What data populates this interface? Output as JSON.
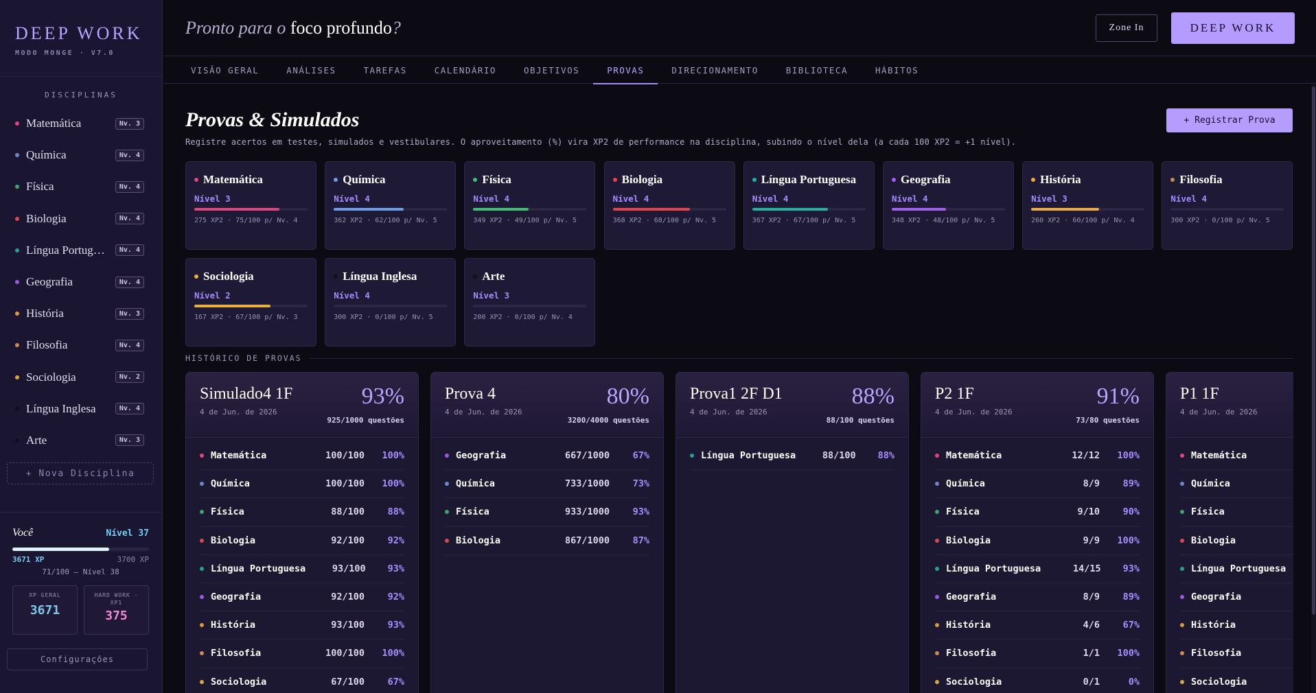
{
  "brand": {
    "title": "DEEP WORK",
    "subtitle": "MODO MONGE · V7.0"
  },
  "sidebar": {
    "heading": "DISCIPLINAS",
    "items": [
      {
        "name": "Matemática",
        "level": "Nv. 3",
        "color": "#e0457f"
      },
      {
        "name": "Química",
        "level": "Nv. 4",
        "color": "#6b86c9"
      },
      {
        "name": "Física",
        "level": "Nv. 4",
        "color": "#3fa36b"
      },
      {
        "name": "Biologia",
        "level": "Nv. 4",
        "color": "#d9474f"
      },
      {
        "name": "Língua Portuguesa",
        "level": "Nv. 4",
        "color": "#25a092"
      },
      {
        "name": "Geografia",
        "level": "Nv. 4",
        "color": "#9b5bd6"
      },
      {
        "name": "História",
        "level": "Nv. 3",
        "color": "#d99a3a"
      },
      {
        "name": "Filosofia",
        "level": "Nv. 4",
        "color": "#c78a54"
      },
      {
        "name": "Sociologia",
        "level": "Nv. 2",
        "color": "#d5a83c"
      },
      {
        "name": "Língua Inglesa",
        "level": "Nv. 4",
        "color": "#111111"
      },
      {
        "name": "Arte",
        "level": "Nv. 3",
        "color": "#111111"
      }
    ],
    "new_label": "+ Nova Disciplina",
    "user": {
      "label": "Você",
      "level": "Nível 37",
      "xp_now": "3671 XP",
      "xp_max": "3700 XP",
      "progress": 0.71,
      "next": "71/100 — Nível 38",
      "stat1_label": "XP GERAL",
      "stat1_value": "3671",
      "stat2_label": "HARD WORK · XP1",
      "stat2_value": "375"
    },
    "settings_label": "Configurações"
  },
  "header": {
    "greeting_pre": "Pronto para o ",
    "greeting_bold": "foco profundo",
    "greeting_post": "?",
    "zone_label": "Zone In",
    "deep_label": "DEEP WORK"
  },
  "tabs": [
    {
      "label": "VISÃO GERAL",
      "active": false
    },
    {
      "label": "ANÁLISES",
      "active": false
    },
    {
      "label": "TAREFAS",
      "active": false
    },
    {
      "label": "CALENDÁRIO",
      "active": false
    },
    {
      "label": "OBJETIVOS",
      "active": false
    },
    {
      "label": "PROVAS",
      "active": true
    },
    {
      "label": "DIRECIONAMENTO",
      "active": false
    },
    {
      "label": "BIBLIOTECA",
      "active": false
    },
    {
      "label": "HÁBITOS",
      "active": false
    }
  ],
  "main": {
    "title": "Provas & Simulados",
    "register_label": "+ Registrar Prova",
    "description": "Registre acertos em testes, simulados e vestibulares. O aproveitamento (%) vira XP2 de performance na disciplina, subindo o nível dela (a cada 100 XP2 = +1 nível).",
    "subjects": [
      {
        "name": "Matemática",
        "level": "Nível 3",
        "xp": "275 XP2 · 75/100 p/ Nv. 4",
        "progress": 0.75,
        "color": "#e0457f"
      },
      {
        "name": "Química",
        "level": "Nível 4",
        "xp": "362 XP2 · 62/100 p/ Nv. 5",
        "progress": 0.62,
        "color": "#6b9ee6"
      },
      {
        "name": "Física",
        "level": "Nível 4",
        "xp": "349 XP2 · 49/100 p/ Nv. 5",
        "progress": 0.49,
        "color": "#3fbf76"
      },
      {
        "name": "Biologia",
        "level": "Nível 4",
        "xp": "368 XP2 · 68/100 p/ Nv. 5",
        "progress": 0.68,
        "color": "#e2434e"
      },
      {
        "name": "Língua Portuguesa",
        "level": "Nível 4",
        "xp": "367 XP2 · 67/100 p/ Nv. 5",
        "progress": 0.67,
        "color": "#22b3a0"
      },
      {
        "name": "Geografia",
        "level": "Nível 4",
        "xp": "348 XP2 · 48/100 p/ Nv. 5",
        "progress": 0.48,
        "color": "#a45ff0"
      },
      {
        "name": "História",
        "level": "Nível 3",
        "xp": "260 XP2 · 60/100 p/ Nv. 4",
        "progress": 0.6,
        "color": "#f0a93c"
      },
      {
        "name": "Filosofia",
        "level": "Nível 4",
        "xp": "300 XP2 · 0/100 p/ Nv. 5",
        "progress": 0.0,
        "color": "#c78a54"
      },
      {
        "name": "Sociologia",
        "level": "Nível 2",
        "xp": "167 XP2 · 67/100 p/ Nv. 3",
        "progress": 0.67,
        "color": "#e8b03c"
      },
      {
        "name": "Língua Inglesa",
        "level": "Nível 4",
        "xp": "300 XP2 · 0/100 p/ Nv. 5",
        "progress": 0.0,
        "color": "#111111"
      },
      {
        "name": "Arte",
        "level": "Nível 3",
        "xp": "200 XP2 · 0/100 p/ Nv. 4",
        "progress": 0.0,
        "color": "#111111"
      }
    ],
    "history_title": "HISTÓRICO DE PROVAS",
    "exams": [
      {
        "name": "Simulado4 1F",
        "date": "4 de Jun. de 2026",
        "pct": "93%",
        "questions": "925/1000 questões",
        "rows": [
          {
            "subject": "Matemática",
            "score": "100/100",
            "pct": "100%",
            "color": "#e0457f"
          },
          {
            "subject": "Química",
            "score": "100/100",
            "pct": "100%",
            "color": "#6b86c9"
          },
          {
            "subject": "Física",
            "score": "88/100",
            "pct": "88%",
            "color": "#3fa36b"
          },
          {
            "subject": "Biologia",
            "score": "92/100",
            "pct": "92%",
            "color": "#d9474f"
          },
          {
            "subject": "Língua Portuguesa",
            "score": "93/100",
            "pct": "93%",
            "color": "#25a092"
          },
          {
            "subject": "Geografia",
            "score": "92/100",
            "pct": "92%",
            "color": "#9b5bd6"
          },
          {
            "subject": "História",
            "score": "93/100",
            "pct": "93%",
            "color": "#d99a3a"
          },
          {
            "subject": "Filosofia",
            "score": "100/100",
            "pct": "100%",
            "color": "#c78a54"
          },
          {
            "subject": "Sociologia",
            "score": "67/100",
            "pct": "67%",
            "color": "#d5a83c"
          }
        ]
      },
      {
        "name": "Prova 4",
        "date": "4 de Jun. de 2026",
        "pct": "80%",
        "questions": "3200/4000 questões",
        "rows": [
          {
            "subject": "Geografia",
            "score": "667/1000",
            "pct": "67%",
            "color": "#9b5bd6"
          },
          {
            "subject": "Química",
            "score": "733/1000",
            "pct": "73%",
            "color": "#6b86c9"
          },
          {
            "subject": "Física",
            "score": "933/1000",
            "pct": "93%",
            "color": "#3fa36b"
          },
          {
            "subject": "Biologia",
            "score": "867/1000",
            "pct": "87%",
            "color": "#d9474f"
          }
        ]
      },
      {
        "name": "Prova1 2F D1",
        "date": "4 de Jun. de 2026",
        "pct": "88%",
        "questions": "88/100 questões",
        "rows": [
          {
            "subject": "Língua Portuguesa",
            "score": "88/100",
            "pct": "88%",
            "color": "#25a092"
          }
        ]
      },
      {
        "name": "P2 1F",
        "date": "4 de Jun. de 2026",
        "pct": "91%",
        "questions": "73/80 questões",
        "rows": [
          {
            "subject": "Matemática",
            "score": "12/12",
            "pct": "100%",
            "color": "#e0457f"
          },
          {
            "subject": "Química",
            "score": "8/9",
            "pct": "89%",
            "color": "#6b86c9"
          },
          {
            "subject": "Física",
            "score": "9/10",
            "pct": "90%",
            "color": "#3fa36b"
          },
          {
            "subject": "Biologia",
            "score": "9/9",
            "pct": "100%",
            "color": "#d9474f"
          },
          {
            "subject": "Língua Portuguesa",
            "score": "14/15",
            "pct": "93%",
            "color": "#25a092"
          },
          {
            "subject": "Geografia",
            "score": "8/9",
            "pct": "89%",
            "color": "#9b5bd6"
          },
          {
            "subject": "História",
            "score": "4/6",
            "pct": "67%",
            "color": "#d99a3a"
          },
          {
            "subject": "Filosofia",
            "score": "1/1",
            "pct": "100%",
            "color": "#c78a54"
          },
          {
            "subject": "Sociologia",
            "score": "0/1",
            "pct": "0%",
            "color": "#d5a83c"
          }
        ]
      },
      {
        "name": "P1 1F",
        "date": "4 de Jun. de 2026",
        "pct": "",
        "questions": "",
        "rows": [
          {
            "subject": "Matemática",
            "score": "",
            "pct": "",
            "color": "#e0457f"
          },
          {
            "subject": "Química",
            "score": "",
            "pct": "",
            "color": "#6b86c9"
          },
          {
            "subject": "Física",
            "score": "",
            "pct": "",
            "color": "#3fa36b"
          },
          {
            "subject": "Biologia",
            "score": "",
            "pct": "",
            "color": "#d9474f"
          },
          {
            "subject": "Língua Portuguesa",
            "score": "",
            "pct": "",
            "color": "#25a092"
          },
          {
            "subject": "Geografia",
            "score": "",
            "pct": "",
            "color": "#9b5bd6"
          },
          {
            "subject": "História",
            "score": "",
            "pct": "",
            "color": "#d99a3a"
          },
          {
            "subject": "Filosofia",
            "score": "",
            "pct": "",
            "color": "#c78a54"
          },
          {
            "subject": "Sociologia",
            "score": "",
            "pct": "",
            "color": "#d5a83c"
          }
        ]
      }
    ]
  }
}
